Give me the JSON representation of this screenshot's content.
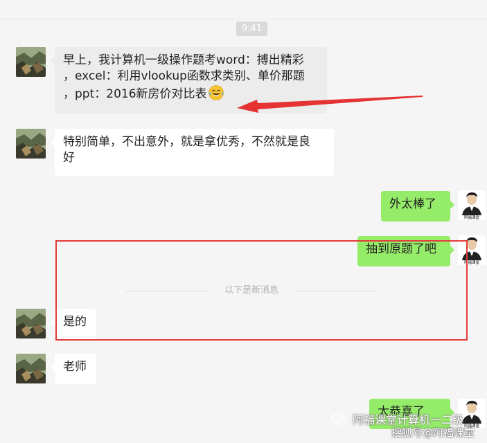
{
  "chat": {
    "timestamp": "9:41",
    "messages": [
      {
        "side": "left",
        "lines": [
          "早上，我计算机一级操作题考word：搏出精彩",
          "，excel：利用vlookup函数求类别、单价那题",
          "，ppt：2016新房价对比表"
        ],
        "emoji": "tears-of-joy"
      },
      {
        "side": "left",
        "lines": [
          "特别简单，不出意外，就是拿优秀，不然就是良",
          "好"
        ]
      },
      {
        "side": "right",
        "lines": [
          "外太棒了"
        ]
      },
      {
        "side": "right",
        "lines": [
          "抽到原题了吧"
        ]
      },
      {
        "side": "left",
        "lines": [
          "是的"
        ]
      },
      {
        "side": "left",
        "lines": [
          "老师"
        ]
      },
      {
        "side": "right",
        "lines": [
          "太恭喜了"
        ]
      }
    ],
    "new_messages_divider": "以下是新消息"
  },
  "right_avatar": {
    "caption": "阿福课堂"
  },
  "annotations": {
    "highlight_color": "#e33b3b"
  },
  "watermark": {
    "line1": "阿福课堂计算机一二级",
    "line2": "搜狐号@阿福课堂"
  },
  "colors": {
    "bubble_self": "#95ec69",
    "bubble_other": "#ffffff",
    "background": "#f5f5f5"
  }
}
